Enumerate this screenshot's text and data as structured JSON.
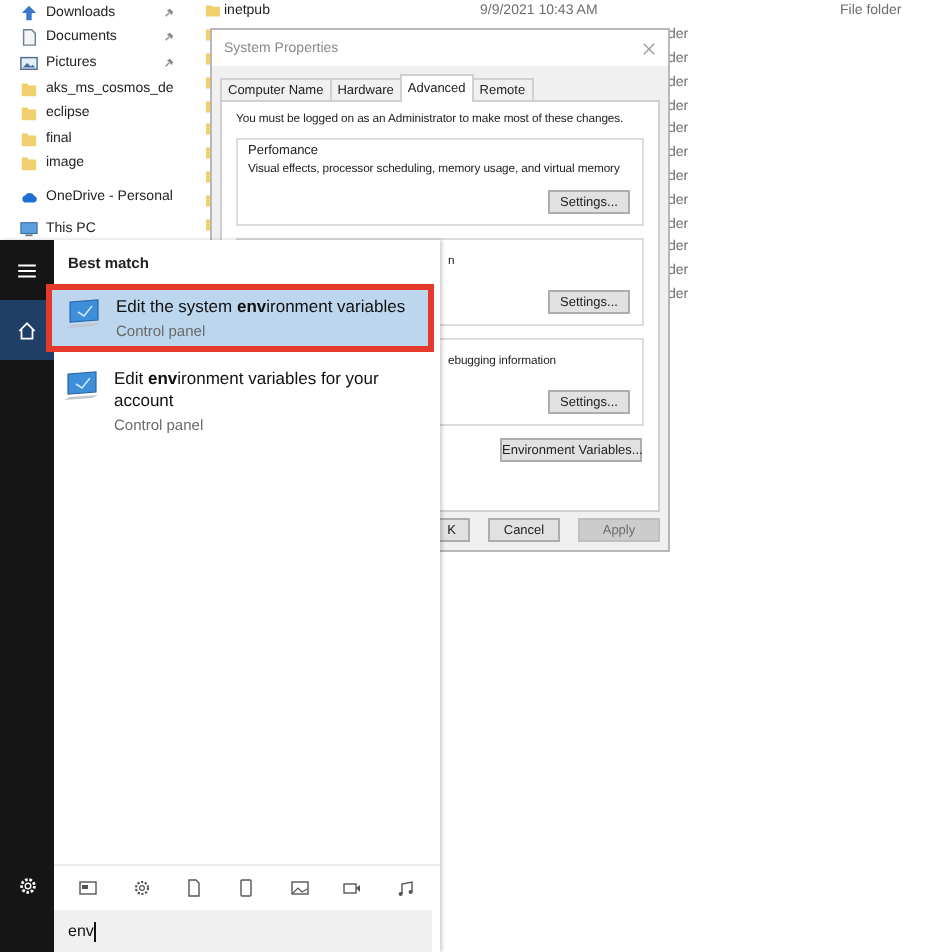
{
  "explorer": {
    "quick_access": [
      {
        "label": "Downloads",
        "kind": "download",
        "pinned": true
      },
      {
        "label": "Documents",
        "kind": "document",
        "pinned": true
      },
      {
        "label": "Pictures",
        "kind": "pictures",
        "pinned": true
      },
      {
        "label": "aks_ms_cosmos_de",
        "kind": "folder",
        "pinned": false
      },
      {
        "label": "eclipse",
        "kind": "folder",
        "pinned": false
      },
      {
        "label": "final",
        "kind": "folder",
        "pinned": false
      },
      {
        "label": "image",
        "kind": "folder",
        "pinned": false
      }
    ],
    "locations": [
      {
        "label": "OneDrive - Personal",
        "kind": "cloud"
      },
      {
        "label": "This PC",
        "kind": "pc"
      }
    ],
    "rows": [
      {
        "name": "inetpub",
        "modified": "9/9/2021 10:43 AM",
        "type": "File folder"
      }
    ],
    "column_3_fragments": [
      "der",
      "der",
      "der",
      "der",
      "der",
      "der",
      "der",
      "der",
      "der",
      "der",
      "der",
      "der"
    ]
  },
  "dialog": {
    "title": "System Properties",
    "tabs": [
      {
        "label": "Computer Name",
        "selected": false
      },
      {
        "label": "Hardware",
        "selected": false
      },
      {
        "label": "Advanced",
        "selected": true
      },
      {
        "label": "Remote",
        "selected": false
      }
    ],
    "note": "You must be logged on as an Administrator to make most of these changes.",
    "groups": [
      {
        "label": "Perfomance",
        "text": "Visual effects, processor scheduling, memory usage, and virtual memory",
        "button": "Settings..."
      },
      {
        "text": "n",
        "button": "Settings..."
      },
      {
        "text": "ebugging information",
        "button": "Settings..."
      }
    ],
    "env_button": "Environment Variables...",
    "buttons": [
      {
        "label": "K",
        "disabled": false
      },
      {
        "label": "Cancel",
        "disabled": false
      },
      {
        "label": "Apply",
        "disabled": true
      }
    ]
  },
  "start_menu": {
    "rail": [
      {
        "kind": "menu",
        "selected": false
      },
      {
        "kind": "home",
        "selected": true
      }
    ],
    "section": "Best match",
    "results": [
      {
        "title": "Edit the system **env**ironment variables",
        "subtitle": "Control panel",
        "selected": true
      },
      {
        "title": "Edit **env**ironment variables for your account",
        "subtitle": "Control panel",
        "selected": false
      }
    ],
    "search": {
      "value": "env"
    }
  }
}
